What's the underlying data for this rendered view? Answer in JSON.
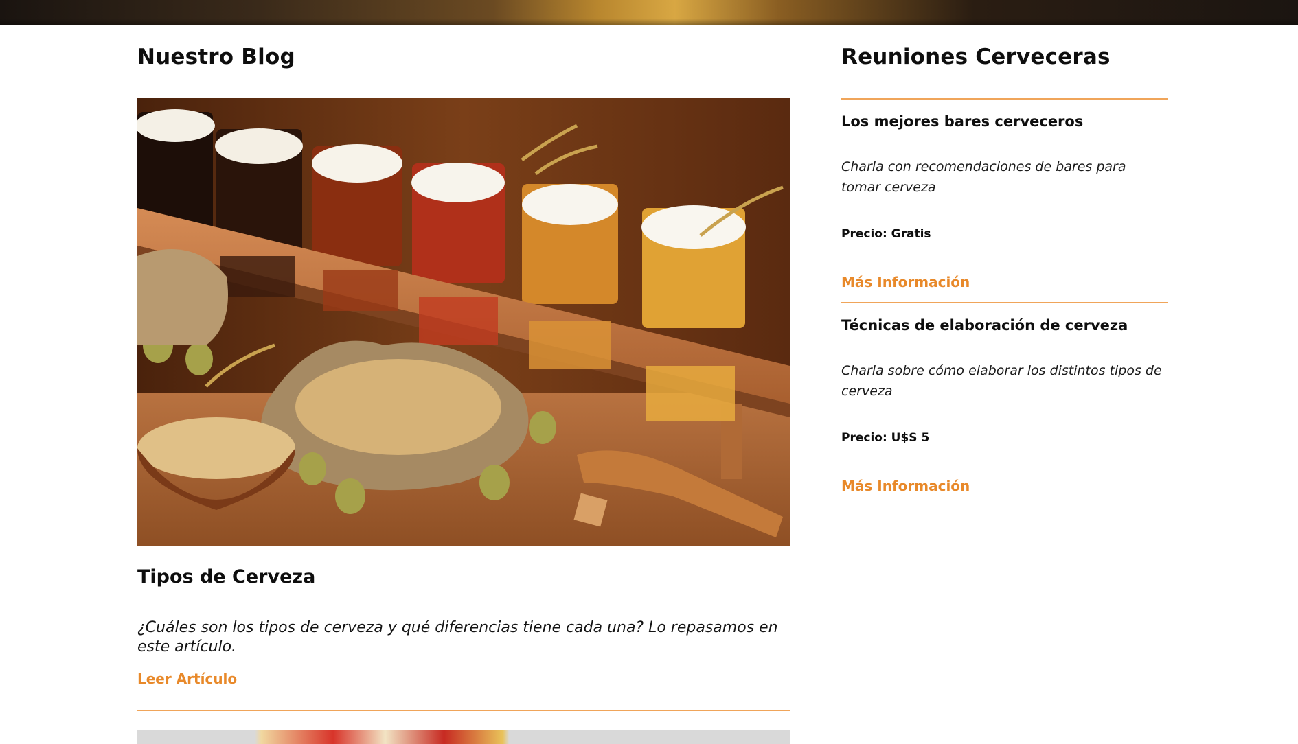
{
  "blog": {
    "heading": "Nuestro Blog",
    "posts": [
      {
        "title": "Tipos de Cerveza",
        "excerpt": "¿Cuáles son los tipos de cerveza y qué diferencias tiene cada una? Lo repasamos en este artículo.",
        "link_label": "Leer Artículo"
      }
    ]
  },
  "events": {
    "heading": "Reuniones Cerveceras",
    "items": [
      {
        "title": "Los mejores bares cerveceros",
        "description": "Charla con recomendaciones de bares para tomar cerveza",
        "price": "Precio: Gratis",
        "link_label": "Más Información"
      },
      {
        "title": "Técnicas de elaboración de cerveza",
        "description": "Charla sobre cómo elaborar los distintos tipos de cerveza",
        "price": "Precio: U$S 5",
        "link_label": "Más Información"
      }
    ]
  },
  "colors": {
    "accent": "#e8892a",
    "divider": "#f0a55a",
    "text": "#0e0e0e"
  }
}
